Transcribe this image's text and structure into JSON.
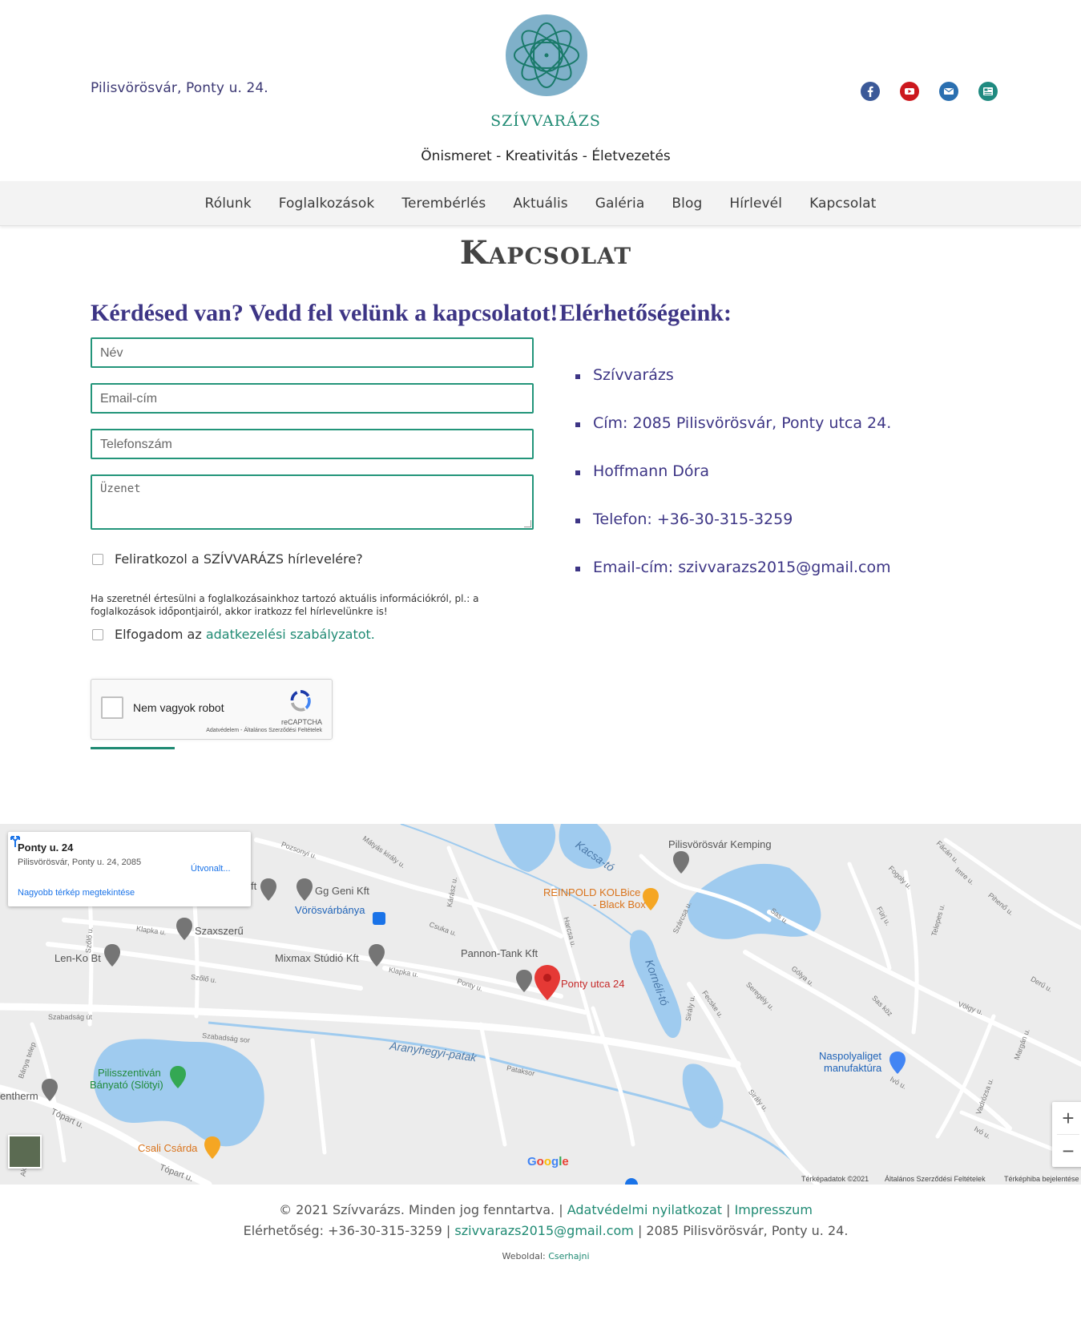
{
  "header": {
    "address": "Pilisvörösvár, Ponty u. 24.",
    "brand": "SZÍVVARÁZS",
    "tagline": "Önismeret - Kreativitás - Életvezetés",
    "socials": [
      {
        "icon": "facebook-icon",
        "color": "#3b5998"
      },
      {
        "icon": "youtube-icon",
        "color": "#cc181e"
      },
      {
        "icon": "email-icon",
        "color": "#2a6fb0"
      },
      {
        "icon": "newsletter-icon",
        "color": "#1f8a80"
      }
    ]
  },
  "nav": {
    "items": [
      "Rólunk",
      "Foglalkozások",
      "Terembérlés",
      "Aktuális",
      "Galéria",
      "Blog",
      "Hírlevél",
      "Kapcsolat"
    ]
  },
  "page": {
    "title": "Kapcsolat"
  },
  "form": {
    "heading": "Kérdésed van? Vedd fel velünk a kapcsolatot!",
    "name_placeholder": "Név",
    "email_placeholder": "Email-cím",
    "phone_placeholder": "Telefonszám",
    "message_placeholder": "Üzenet",
    "subscribe_label": "Feliratkozol a SZÍVVARÁZS hírlevelére?",
    "subscribe_note": "Ha szeretnél értesülni a foglalkozásainkhoz tartozó aktuális információkról, pl.: a foglalkozások időpontjairól, akkor iratkozz fel hírlevelünkre is!",
    "privacy_prefix": "Elfogadom az ",
    "privacy_link": "adatkezelési szabályzatot.",
    "recaptcha": {
      "label": "Nem vagyok robot",
      "brand": "reCAPTCHA",
      "terms": "Adatvédelem - Általános Szerződési Feltételek"
    }
  },
  "contact": {
    "heading": "Elérhetőségeink:",
    "items": [
      "Szívvarázs",
      "Cím: 2085 Pilisvörösvár, Ponty utca 24.",
      "Hoffmann Dóra",
      "Telefon: +36-30-315-3259",
      "Email-cím: szivvarazs2015@gmail.com"
    ]
  },
  "map": {
    "card_title": "Ponty u. 24",
    "card_address": "Pilisvörösvár, Ponty u. 24, 2085",
    "card_route": "Útvonalt...",
    "card_bigger_map": "Nagyobb térkép megtekintése",
    "places": {
      "kemping": "Pilisvörösvár Kemping",
      "reinpold": "REINPOLD KOLBice",
      "reinpold2": "- Black Box",
      "gg_geni": "Gg Geni Kft",
      "ft": "ft",
      "vorosvarbanya": "Vörösvárbánya",
      "szaxszeru": "Szaxszerű",
      "lenko": "Len-Ko Bt",
      "mixmax": "Mixmax Stúdió Kft",
      "pannon": "Pannon-Tank Kft",
      "ponty": "Ponty utca 24",
      "napsugar": "Naspolyaliget",
      "napsugar2": "manufaktúra",
      "banyato": "Pilisszentiván",
      "banyato2": "Bányató (Slötyi)",
      "entherm": "entherm",
      "csali": "Csali Csárda",
      "kacsa": "Kacsa-tó",
      "korneli": "Kornéli-tó",
      "aranyhegyi": "Aranyhegyi-patak"
    },
    "roads": {
      "pozsonyi": "Pozsonyi u.",
      "matyas": "Mátyás király u.",
      "karasz": "Kárász u.",
      "csuka": "Csuka u.",
      "klapka": "Klapka u.",
      "klapka2": "Klapka u.",
      "szolo": "Szőlő u.",
      "szolo2": "Szőlő u.",
      "szabadsag_ut": "Szabadság út",
      "szabadsag_sor": "Szabadság sor",
      "harcsa": "Harcsa u.",
      "ponty_road": "Ponty u.",
      "pataksor": "Pataksor",
      "toppart": "Tópart u.",
      "toppart2": "Tópart u.",
      "szarcsa": "Szárcsa u.",
      "fecske": "Fecske u.",
      "siraly": "Sirály u.",
      "siraly2": "Sirály u.",
      "sas": "Sas u.",
      "gorlya": "Gólya u.",
      "seregely": "Seregély u.",
      "sas_koz": "Sas köz",
      "fogoly": "Fogoly u.",
      "fury": "Fürj u.",
      "telepes": "Telepes u.",
      "facan": "Fácán u.",
      "imre": "Imre u.",
      "pihenő": "Pihenő u.",
      "deru": "Derű u.",
      "volgy": "Völgy u.",
      "margan": "Margán u.",
      "ivo": "Ivó u.",
      "ivo2": "Ivó u.",
      "vadrozsa": "Vadrózsa u.",
      "banya": "Bánya telep",
      "akac": "Akác"
    },
    "zoom_in": "+",
    "zoom_out": "−",
    "google": "Google",
    "attribution": "Térképadatok ©2021",
    "terms": "Általános Szerződési Feltételek",
    "report": "Térképhiba bejelentése"
  },
  "footer": {
    "copyright": "© 2021 Szívvarázs. Minden jog fenntartva. | ",
    "privacy": "Adatvédelmi nyilatkozat",
    "sep": " | ",
    "impresszum": "Impresszum",
    "contact_prefix": "Elérhetőség: +36-30-315-3259 | ",
    "email": "szivvarazs2015@gmail.com",
    "contact_suffix": " | 2085 Pilisvörösvár, Ponty u. 24.",
    "website_prefix": "Weboldal: ",
    "website_author": "Cserhajni"
  },
  "colors": {
    "accent": "#1f8a73",
    "heading": "#3d3585",
    "nav_bg": "#f3f3f3"
  }
}
